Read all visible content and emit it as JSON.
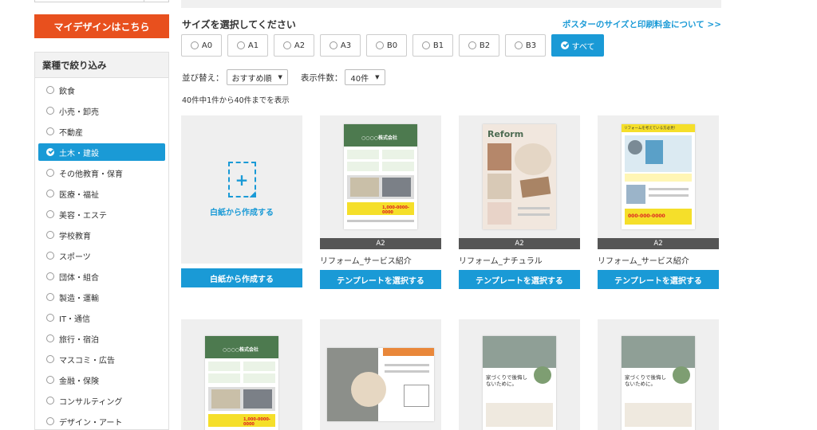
{
  "sidebar": {
    "my_design_label": "マイデザインはこちら",
    "filter_title": "業種で絞り込み",
    "items": [
      {
        "label": "飲食",
        "active": false
      },
      {
        "label": "小売・卸売",
        "active": false
      },
      {
        "label": "不動産",
        "active": false
      },
      {
        "label": "土木・建設",
        "active": true
      },
      {
        "label": "その他教育・保育",
        "active": false
      },
      {
        "label": "医療・福祉",
        "active": false
      },
      {
        "label": "美容・エステ",
        "active": false
      },
      {
        "label": "学校教育",
        "active": false
      },
      {
        "label": "スポーツ",
        "active": false
      },
      {
        "label": "団体・組合",
        "active": false
      },
      {
        "label": "製造・運輸",
        "active": false
      },
      {
        "label": "IT・通信",
        "active": false
      },
      {
        "label": "旅行・宿泊",
        "active": false
      },
      {
        "label": "マスコミ・広告",
        "active": false
      },
      {
        "label": "金融・保険",
        "active": false
      },
      {
        "label": "コンサルティング",
        "active": false
      },
      {
        "label": "デザイン・アート",
        "active": false
      }
    ]
  },
  "main": {
    "size_heading": "サイズを選択してください",
    "size_link": "ポスターのサイズと印刷料金について >>",
    "sizes": [
      {
        "label": "A0",
        "active": false
      },
      {
        "label": "A1",
        "active": false
      },
      {
        "label": "A2",
        "active": false
      },
      {
        "label": "A3",
        "active": false
      },
      {
        "label": "B0",
        "active": false
      },
      {
        "label": "B1",
        "active": false
      },
      {
        "label": "B2",
        "active": false
      },
      {
        "label": "B3",
        "active": false
      },
      {
        "label": "すべて",
        "active": true
      }
    ],
    "sort_label": "並び替え：",
    "sort_value": "おすすめ順",
    "count_label": "表示件数：",
    "count_value": "40件",
    "result_text": "40件中1件から40件までを表示",
    "blank_card": {
      "label": "白紙から作成する",
      "button": "白紙から作成する"
    },
    "cards_row1": [
      {
        "size": "A2",
        "title": "リフォーム_サービス紹介",
        "button": "テンプレートを選択する"
      },
      {
        "size": "A2",
        "title": "リフォーム_ナチュラル",
        "button": "テンプレートを選択する"
      },
      {
        "size": "A2",
        "title": "リフォーム_サービス紹介",
        "button": "テンプレートを選択する"
      }
    ],
    "poster_texts": {
      "p1_title": "○○○○株式会社",
      "p1_phone": "1,000-0000-0000",
      "p2_title": "Reform",
      "p3_heading": "リフォームを考えている方必見！",
      "p3_phone": "000-000-0000",
      "r2_p3_text": "家づくりで後悔しないために。"
    }
  }
}
